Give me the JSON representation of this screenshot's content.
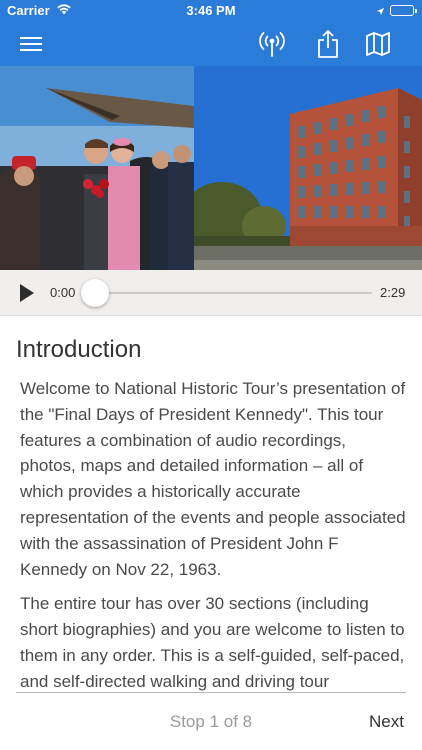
{
  "status_bar": {
    "carrier": "Carrier",
    "time": "3:46 PM",
    "battery_level": 1.0
  },
  "nav_bar": {
    "background_color": "#2b7bd8",
    "icons": [
      "hamburger-menu-icon",
      "broadcast-icon",
      "share-icon",
      "map-icon"
    ]
  },
  "hero": {
    "left_image": "Photo of President Kennedy and First Lady greeting crowd on airfield",
    "right_image": "Photo of red brick building under blue sky"
  },
  "player": {
    "elapsed": "0:00",
    "duration": "2:29",
    "progress": 0.0
  },
  "content": {
    "title": "Introduction",
    "paragraphs": [
      "Welcome to National Historic Tour’s presentation of the \"Final Days of President Kennedy\". This tour features a combination of audio recordings, photos, maps and detailed information – all of which provides a historically accurate representation of the events and people associated with the assassination of President John F Kennedy on Nov 22, 1963.",
      "The entire tour has over 30 sections (including short biographies) and you are welcome to listen to them in any order. This is a self-guided, self-paced, and self-directed walking and driving tour"
    ]
  },
  "footer": {
    "stop_label": "Stop 1 of 8",
    "next_label": "Next"
  }
}
